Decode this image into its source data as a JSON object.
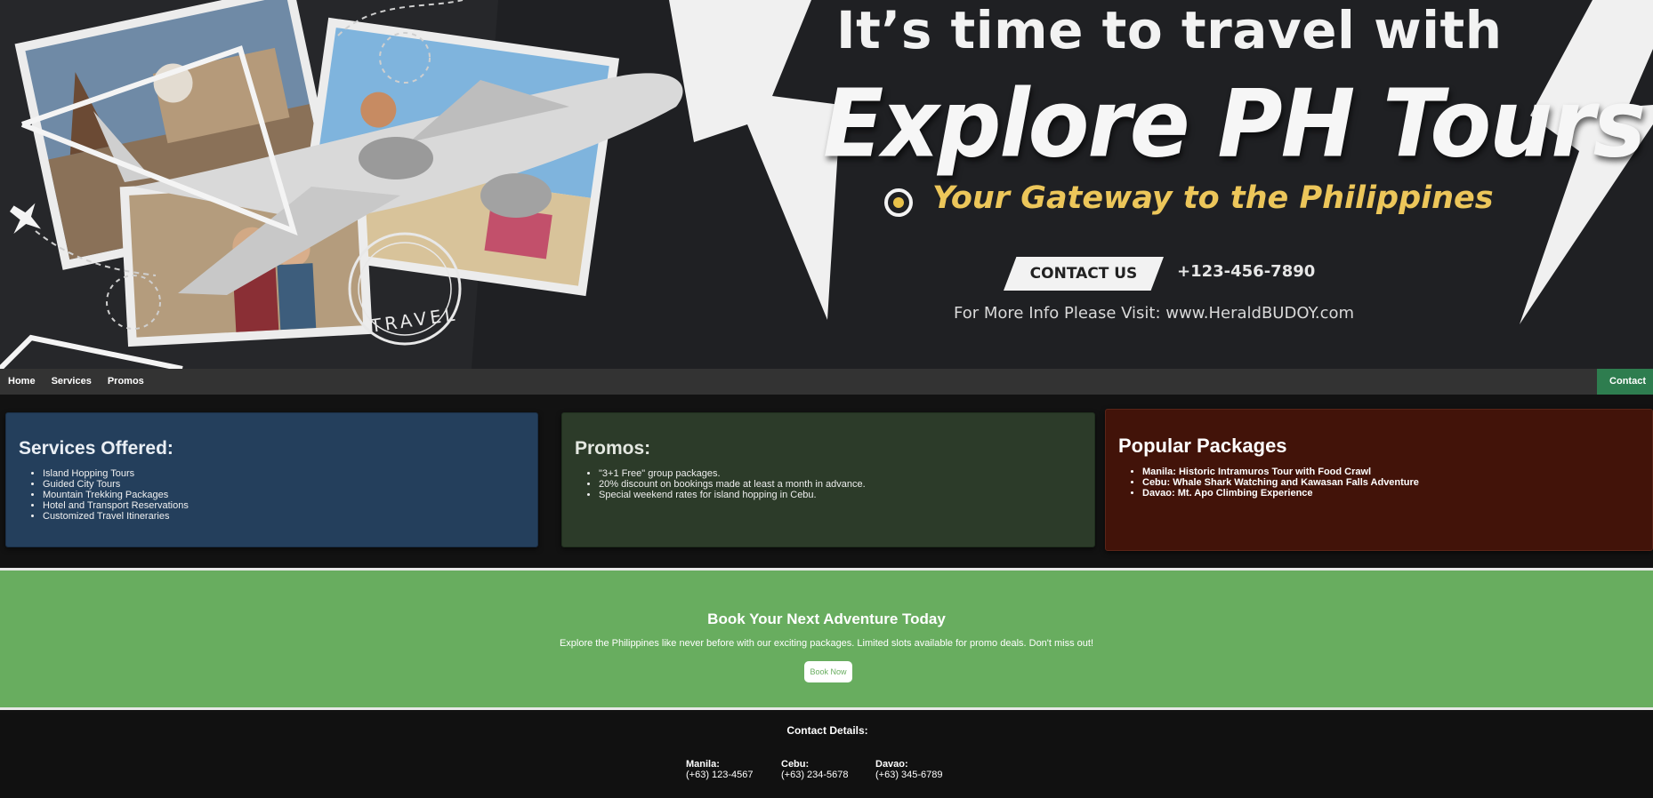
{
  "hero": {
    "headline_line1": "It’s time to travel with",
    "headline_line2": "Explore PH Tours",
    "tagline": "Your Gateway to the Philippines",
    "contact_button": "CONTACT US",
    "phone": "+123-456-7890",
    "visit_text": "For More Info Please Visit: www.HeraldBUDOY.com",
    "stamp_text": "TRAVEL",
    "colors": {
      "background": "#1f2023",
      "tagline": "#ecc65a"
    }
  },
  "nav": {
    "items": [
      {
        "label": "Home"
      },
      {
        "label": "Services"
      },
      {
        "label": "Promos"
      }
    ],
    "contact_label": "Contact",
    "contact_color": "#2e7d4f"
  },
  "services": {
    "title": "Services Offered:",
    "items": [
      "Island Hopping Tours",
      "Guided City Tours",
      "Mountain Trekking Packages",
      "Hotel and Transport Reservations",
      "Customized Travel Itineraries"
    ],
    "color": "#243f5c"
  },
  "promos": {
    "title": "Promos:",
    "items": [
      "\"3+1 Free\" group packages.",
      "20% discount on bookings made at least a month in advance.",
      "Special weekend rates for island hopping in Cebu."
    ],
    "color": "#2c3b29"
  },
  "packages": {
    "title": "Popular Packages",
    "items": [
      {
        "place": "Manila:",
        "desc": "Historic Intramuros Tour with Food Crawl"
      },
      {
        "place": "Cebu:",
        "desc": "Whale Shark Watching and Kawasan Falls Adventure"
      },
      {
        "place": "Davao:",
        "desc": "Mt. Apo Climbing Experience"
      }
    ],
    "color": "#421309"
  },
  "cta": {
    "title": "Book Your Next Adventure Today",
    "text": "Explore the Philippines like never before with our exciting packages. Limited slots available for promo deals. Don't miss out!",
    "button": "Book Now",
    "color": "#68ad5f"
  },
  "footer": {
    "title": "Contact Details:",
    "offices": [
      {
        "city": "Manila:",
        "phone": "(+63) 123-4567"
      },
      {
        "city": "Cebu:",
        "phone": "(+63) 234-5678"
      },
      {
        "city": "Davao:",
        "phone": "(+63) 345-6789"
      }
    ]
  }
}
